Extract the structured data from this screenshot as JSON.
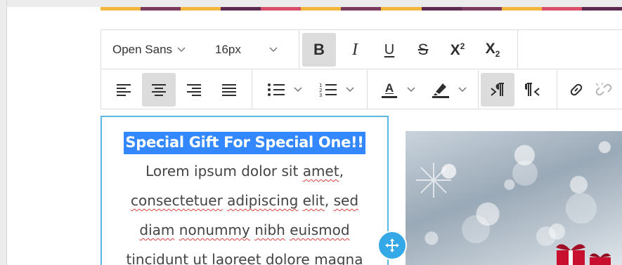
{
  "colors": {
    "accent_bar": [
      "#f2b63c",
      "#7a3b5e",
      "#f2b63c",
      "#5c2a4f",
      "#d94f6b",
      "#f2b63c",
      "#7a3b5e",
      "#f2b63c",
      "#5c2a4f",
      "#7a3b5e",
      "#f2b63c",
      "#d94f6b",
      "#5c2a4f"
    ],
    "selection": "#3388ff",
    "frame": "#5bb8e2",
    "handle": "#35a9e8"
  },
  "toolbar": {
    "font_family": "Open Sans",
    "font_size": "16px",
    "superscript_label": "X",
    "superscript_mark": "2",
    "subscript_label": "X",
    "subscript_mark": "2",
    "bold_label": "B",
    "italic_label": "I",
    "underline_label": "U",
    "strike_label": "S",
    "text_color_label": "A",
    "active": [
      "bold",
      "align-center",
      "direction-ltr"
    ]
  },
  "content": {
    "headline": "Special Gift For Special One!!",
    "lines": [
      [
        {
          "t": "Lorem ipsum dolor sit "
        },
        {
          "t": "amet",
          "sp": true
        },
        {
          "t": ","
        }
      ],
      [
        {
          "t": "consectetuer",
          "sp": true
        },
        {
          "t": " "
        },
        {
          "t": "adipiscing",
          "sp": true
        },
        {
          "t": " "
        },
        {
          "t": "elit",
          "sp": true
        },
        {
          "t": ", "
        },
        {
          "t": "sed",
          "sp": true
        }
      ],
      [
        {
          "t": "diam",
          "sp": true
        },
        {
          "t": " "
        },
        {
          "t": "nonummy",
          "sp": true
        },
        {
          "t": " "
        },
        {
          "t": "nibh",
          "sp": true
        },
        {
          "t": " "
        },
        {
          "t": "euismod",
          "sp": true
        }
      ],
      [
        {
          "t": "tincidunt ut laoreet dolore magna"
        }
      ]
    ]
  }
}
